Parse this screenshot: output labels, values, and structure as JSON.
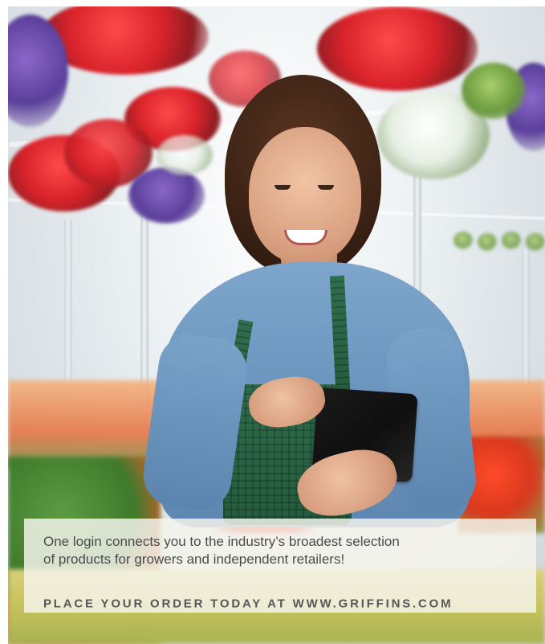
{
  "caption": {
    "line1": "One login connects you to the industry’s broadest selection",
    "line2": "of products for growers and independent retailers!",
    "cta": "PLACE YOUR ORDER TODAY AT WWW.GRIFFINS.COM"
  }
}
